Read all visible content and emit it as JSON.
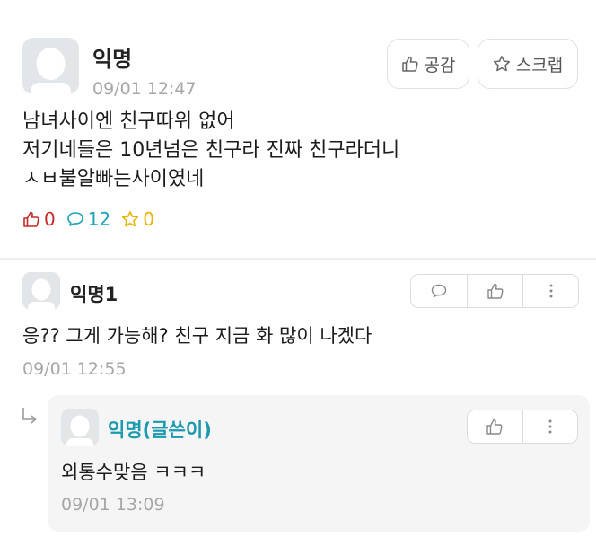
{
  "post": {
    "author": "익명",
    "time": "09/01 12:47",
    "like_button": "공감",
    "scrap_button": "스크랩",
    "body_lines": [
      "남녀사이엔 친구따위 없어",
      "저기네들은 10년넘은 친구라 진짜 친구라더니",
      "ㅅㅂ불알빠는사이였네"
    ],
    "stats": {
      "likes": "0",
      "comments": "12",
      "scraps": "0"
    }
  },
  "comments": [
    {
      "author": "익명1",
      "text": "응?? 그게 가능해? 친구 지금 화 많이 나겠다",
      "time": "09/01 12:55"
    },
    {
      "author": "익명(글쓴이)",
      "text": "외통수맞음 ㅋㅋㅋ",
      "time": "09/01 13:09",
      "is_reply": true
    }
  ],
  "icons": {
    "like": "thumbs-up-icon",
    "scrap": "star-icon",
    "comment": "speech-bubble-icon",
    "more": "more-vertical-icon",
    "reply": "reply-arrow-icon",
    "avatar": "default-avatar-icon"
  },
  "colors": {
    "like_stat": "#c62828",
    "comment_stat": "#1aa3b8",
    "scrap_stat": "#e7b400",
    "author_highlight": "#1a9ab0"
  }
}
